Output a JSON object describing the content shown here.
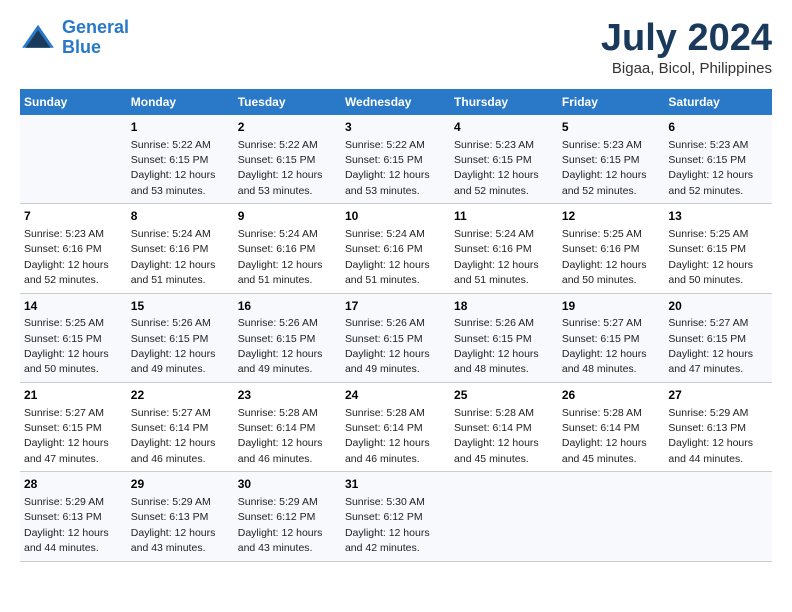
{
  "logo": {
    "line1": "General",
    "line2": "Blue"
  },
  "title": "July 2024",
  "subtitle": "Bigaa, Bicol, Philippines",
  "header": {
    "colors": {
      "accent": "#2979c8"
    }
  },
  "days_of_week": [
    "Sunday",
    "Monday",
    "Tuesday",
    "Wednesday",
    "Thursday",
    "Friday",
    "Saturday"
  ],
  "weeks": [
    {
      "cells": [
        {
          "day": "",
          "sunrise": "",
          "sunset": "",
          "daylight": ""
        },
        {
          "day": "1",
          "sunrise": "Sunrise: 5:22 AM",
          "sunset": "Sunset: 6:15 PM",
          "daylight": "Daylight: 12 hours and 53 minutes."
        },
        {
          "day": "2",
          "sunrise": "Sunrise: 5:22 AM",
          "sunset": "Sunset: 6:15 PM",
          "daylight": "Daylight: 12 hours and 53 minutes."
        },
        {
          "day": "3",
          "sunrise": "Sunrise: 5:22 AM",
          "sunset": "Sunset: 6:15 PM",
          "daylight": "Daylight: 12 hours and 53 minutes."
        },
        {
          "day": "4",
          "sunrise": "Sunrise: 5:23 AM",
          "sunset": "Sunset: 6:15 PM",
          "daylight": "Daylight: 12 hours and 52 minutes."
        },
        {
          "day": "5",
          "sunrise": "Sunrise: 5:23 AM",
          "sunset": "Sunset: 6:15 PM",
          "daylight": "Daylight: 12 hours and 52 minutes."
        },
        {
          "day": "6",
          "sunrise": "Sunrise: 5:23 AM",
          "sunset": "Sunset: 6:15 PM",
          "daylight": "Daylight: 12 hours and 52 minutes."
        }
      ]
    },
    {
      "cells": [
        {
          "day": "7",
          "sunrise": "Sunrise: 5:23 AM",
          "sunset": "Sunset: 6:16 PM",
          "daylight": "Daylight: 12 hours and 52 minutes."
        },
        {
          "day": "8",
          "sunrise": "Sunrise: 5:24 AM",
          "sunset": "Sunset: 6:16 PM",
          "daylight": "Daylight: 12 hours and 51 minutes."
        },
        {
          "day": "9",
          "sunrise": "Sunrise: 5:24 AM",
          "sunset": "Sunset: 6:16 PM",
          "daylight": "Daylight: 12 hours and 51 minutes."
        },
        {
          "day": "10",
          "sunrise": "Sunrise: 5:24 AM",
          "sunset": "Sunset: 6:16 PM",
          "daylight": "Daylight: 12 hours and 51 minutes."
        },
        {
          "day": "11",
          "sunrise": "Sunrise: 5:24 AM",
          "sunset": "Sunset: 6:16 PM",
          "daylight": "Daylight: 12 hours and 51 minutes."
        },
        {
          "day": "12",
          "sunrise": "Sunrise: 5:25 AM",
          "sunset": "Sunset: 6:16 PM",
          "daylight": "Daylight: 12 hours and 50 minutes."
        },
        {
          "day": "13",
          "sunrise": "Sunrise: 5:25 AM",
          "sunset": "Sunset: 6:15 PM",
          "daylight": "Daylight: 12 hours and 50 minutes."
        }
      ]
    },
    {
      "cells": [
        {
          "day": "14",
          "sunrise": "Sunrise: 5:25 AM",
          "sunset": "Sunset: 6:15 PM",
          "daylight": "Daylight: 12 hours and 50 minutes."
        },
        {
          "day": "15",
          "sunrise": "Sunrise: 5:26 AM",
          "sunset": "Sunset: 6:15 PM",
          "daylight": "Daylight: 12 hours and 49 minutes."
        },
        {
          "day": "16",
          "sunrise": "Sunrise: 5:26 AM",
          "sunset": "Sunset: 6:15 PM",
          "daylight": "Daylight: 12 hours and 49 minutes."
        },
        {
          "day": "17",
          "sunrise": "Sunrise: 5:26 AM",
          "sunset": "Sunset: 6:15 PM",
          "daylight": "Daylight: 12 hours and 49 minutes."
        },
        {
          "day": "18",
          "sunrise": "Sunrise: 5:26 AM",
          "sunset": "Sunset: 6:15 PM",
          "daylight": "Daylight: 12 hours and 48 minutes."
        },
        {
          "day": "19",
          "sunrise": "Sunrise: 5:27 AM",
          "sunset": "Sunset: 6:15 PM",
          "daylight": "Daylight: 12 hours and 48 minutes."
        },
        {
          "day": "20",
          "sunrise": "Sunrise: 5:27 AM",
          "sunset": "Sunset: 6:15 PM",
          "daylight": "Daylight: 12 hours and 47 minutes."
        }
      ]
    },
    {
      "cells": [
        {
          "day": "21",
          "sunrise": "Sunrise: 5:27 AM",
          "sunset": "Sunset: 6:15 PM",
          "daylight": "Daylight: 12 hours and 47 minutes."
        },
        {
          "day": "22",
          "sunrise": "Sunrise: 5:27 AM",
          "sunset": "Sunset: 6:14 PM",
          "daylight": "Daylight: 12 hours and 46 minutes."
        },
        {
          "day": "23",
          "sunrise": "Sunrise: 5:28 AM",
          "sunset": "Sunset: 6:14 PM",
          "daylight": "Daylight: 12 hours and 46 minutes."
        },
        {
          "day": "24",
          "sunrise": "Sunrise: 5:28 AM",
          "sunset": "Sunset: 6:14 PM",
          "daylight": "Daylight: 12 hours and 46 minutes."
        },
        {
          "day": "25",
          "sunrise": "Sunrise: 5:28 AM",
          "sunset": "Sunset: 6:14 PM",
          "daylight": "Daylight: 12 hours and 45 minutes."
        },
        {
          "day": "26",
          "sunrise": "Sunrise: 5:28 AM",
          "sunset": "Sunset: 6:14 PM",
          "daylight": "Daylight: 12 hours and 45 minutes."
        },
        {
          "day": "27",
          "sunrise": "Sunrise: 5:29 AM",
          "sunset": "Sunset: 6:13 PM",
          "daylight": "Daylight: 12 hours and 44 minutes."
        }
      ]
    },
    {
      "cells": [
        {
          "day": "28",
          "sunrise": "Sunrise: 5:29 AM",
          "sunset": "Sunset: 6:13 PM",
          "daylight": "Daylight: 12 hours and 44 minutes."
        },
        {
          "day": "29",
          "sunrise": "Sunrise: 5:29 AM",
          "sunset": "Sunset: 6:13 PM",
          "daylight": "Daylight: 12 hours and 43 minutes."
        },
        {
          "day": "30",
          "sunrise": "Sunrise: 5:29 AM",
          "sunset": "Sunset: 6:12 PM",
          "daylight": "Daylight: 12 hours and 43 minutes."
        },
        {
          "day": "31",
          "sunrise": "Sunrise: 5:30 AM",
          "sunset": "Sunset: 6:12 PM",
          "daylight": "Daylight: 12 hours and 42 minutes."
        },
        {
          "day": "",
          "sunrise": "",
          "sunset": "",
          "daylight": ""
        },
        {
          "day": "",
          "sunrise": "",
          "sunset": "",
          "daylight": ""
        },
        {
          "day": "",
          "sunrise": "",
          "sunset": "",
          "daylight": ""
        }
      ]
    }
  ]
}
